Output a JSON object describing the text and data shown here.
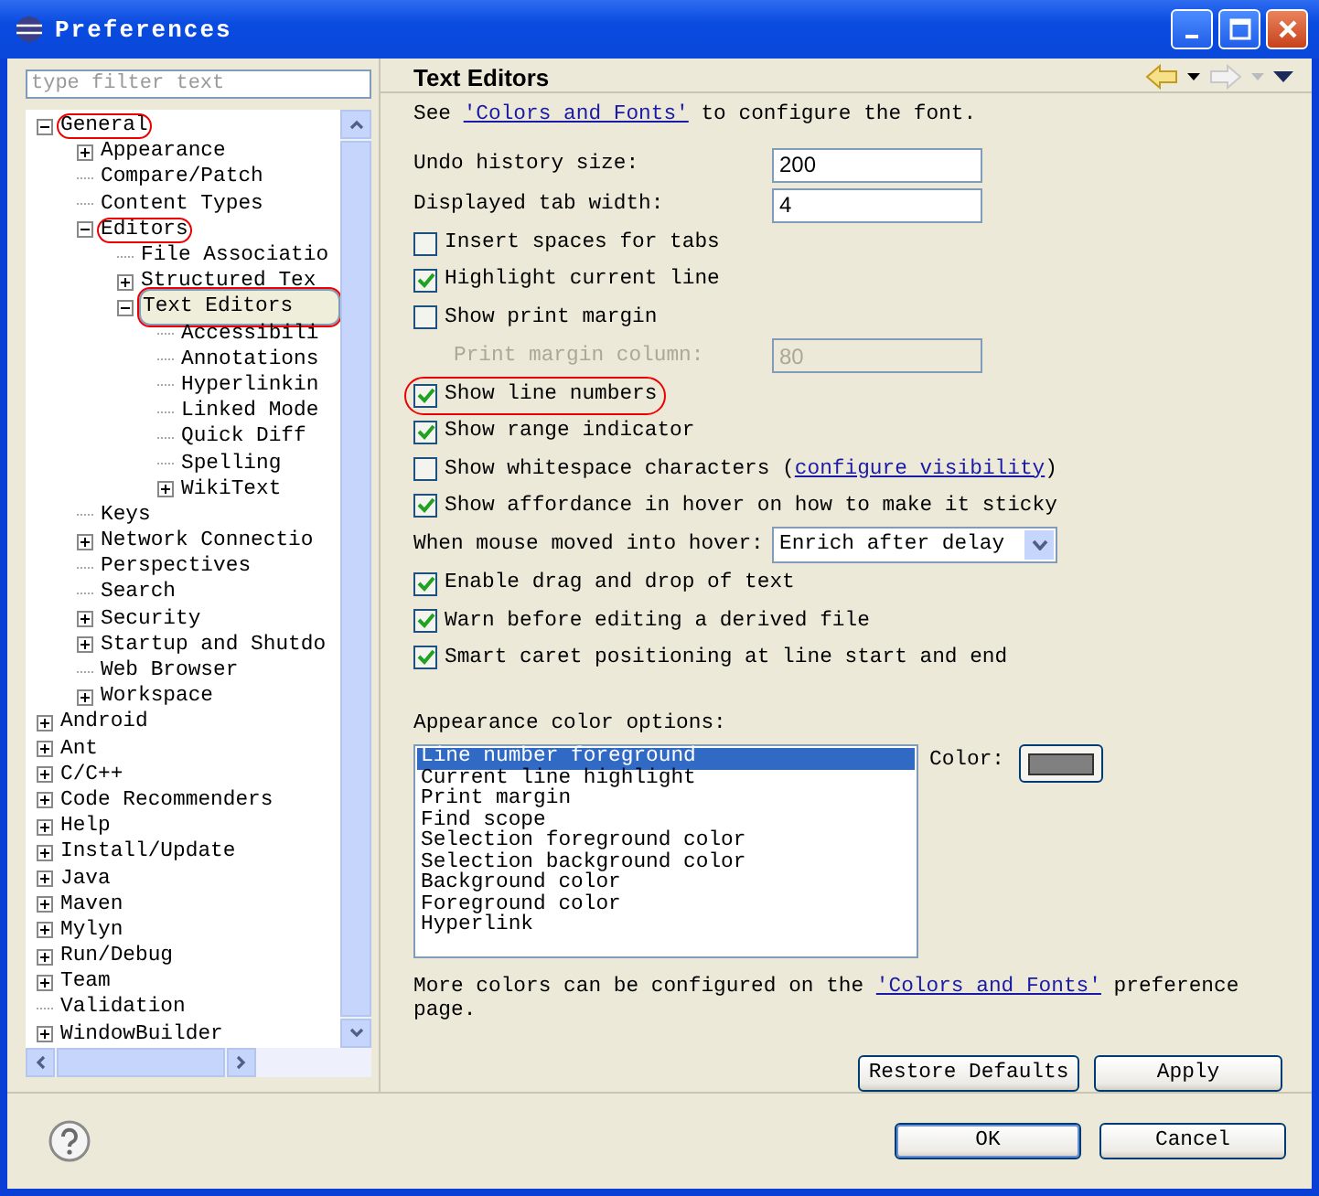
{
  "window": {
    "title": "Preferences"
  },
  "sidebar": {
    "filter": {
      "placeholder": "type filter text"
    },
    "tree": [
      {
        "label": "General",
        "expanded": true,
        "selected": false,
        "circled": true,
        "children": [
          {
            "label": "Appearance",
            "expanded": false,
            "selected": false,
            "circled": false
          },
          {
            "label": "Compare/Patch",
            "selected": false,
            "circled": false
          },
          {
            "label": "Content Types",
            "selected": false,
            "circled": false
          },
          {
            "label": "Editors",
            "expanded": true,
            "selected": false,
            "circled": true,
            "children": [
              {
                "label": "File Associatio",
                "selected": false,
                "circled": false
              },
              {
                "label": "Structured Tex",
                "expanded": false,
                "selected": false,
                "circled": false
              },
              {
                "label": "Text Editors",
                "expanded": true,
                "selected": true,
                "circled": true,
                "children": [
                  {
                    "label": "Accessibili",
                    "selected": false,
                    "circled": false
                  },
                  {
                    "label": "Annotations",
                    "selected": false,
                    "circled": false
                  },
                  {
                    "label": "Hyperlinkin",
                    "selected": false,
                    "circled": false
                  },
                  {
                    "label": "Linked Mode",
                    "selected": false,
                    "circled": false
                  },
                  {
                    "label": "Quick Diff",
                    "selected": false,
                    "circled": false
                  },
                  {
                    "label": "Spelling",
                    "selected": false,
                    "circled": false
                  },
                  {
                    "label": "WikiText",
                    "expanded": false,
                    "selected": false,
                    "circled": false
                  }
                ]
              }
            ]
          },
          {
            "label": "Keys",
            "selected": false,
            "circled": false
          },
          {
            "label": "Network Connectio",
            "expanded": false,
            "selected": false,
            "circled": false
          },
          {
            "label": "Perspectives",
            "selected": false,
            "circled": false
          },
          {
            "label": "Search",
            "selected": false,
            "circled": false
          },
          {
            "label": "Security",
            "expanded": false,
            "selected": false,
            "circled": false
          },
          {
            "label": "Startup and Shutdo",
            "expanded": false,
            "selected": false,
            "circled": false
          },
          {
            "label": "Web Browser",
            "selected": false,
            "circled": false
          },
          {
            "label": "Workspace",
            "expanded": false,
            "selected": false,
            "circled": false
          }
        ]
      },
      {
        "label": "Android",
        "expanded": false,
        "selected": false,
        "circled": false
      },
      {
        "label": "Ant",
        "expanded": false,
        "selected": false,
        "circled": false
      },
      {
        "label": "C/C++",
        "expanded": false,
        "selected": false,
        "circled": false
      },
      {
        "label": "Code Recommenders",
        "expanded": false,
        "selected": false,
        "circled": false
      },
      {
        "label": "Help",
        "expanded": false,
        "selected": false,
        "circled": false
      },
      {
        "label": "Install/Update",
        "expanded": false,
        "selected": false,
        "circled": false
      },
      {
        "label": "Java",
        "expanded": false,
        "selected": false,
        "circled": false
      },
      {
        "label": "Maven",
        "expanded": false,
        "selected": false,
        "circled": false
      },
      {
        "label": "Mylyn",
        "expanded": false,
        "selected": false,
        "circled": false
      },
      {
        "label": "Run/Debug",
        "expanded": false,
        "selected": false,
        "circled": false
      },
      {
        "label": "Team",
        "expanded": false,
        "selected": false,
        "circled": false
      },
      {
        "label": "Validation",
        "selected": false,
        "circled": false
      },
      {
        "label": "WindowBuilder",
        "expanded": false,
        "selected": false,
        "circled": false
      }
    ]
  },
  "page": {
    "title": "Text Editors",
    "intro": {
      "before": "See ",
      "link": "'Colors and Fonts'",
      "after": " to configure the font."
    },
    "options": [
      {
        "kind": "input",
        "label": "Undo history size:",
        "value": "200",
        "disabled": false
      },
      {
        "kind": "input",
        "label": "Displayed tab width:",
        "value": "4",
        "disabled": false
      },
      {
        "kind": "checkbox",
        "label": "Insert spaces for tabs",
        "checked": false,
        "circled": false
      },
      {
        "kind": "checkbox",
        "label": "Highlight current line",
        "checked": true,
        "circled": false
      },
      {
        "kind": "checkbox",
        "label": "Show print margin",
        "checked": false,
        "circled": false
      },
      {
        "kind": "input",
        "label": "Print margin column:",
        "value": "80",
        "disabled": true
      },
      {
        "kind": "checkbox",
        "label": "Show line numbers",
        "checked": true,
        "circled": true
      },
      {
        "kind": "checkbox",
        "label": "Show range indicator",
        "checked": true,
        "circled": false
      },
      {
        "kind": "checkbox",
        "label": "Show whitespace characters (",
        "link": "configure visibility",
        "after": ")",
        "checked": false,
        "circled": false
      },
      {
        "kind": "checkbox",
        "label": "Show affordance in hover on how to make it sticky",
        "checked": true,
        "circled": false
      },
      {
        "kind": "select",
        "label": "When mouse moved into hover:",
        "value": "Enrich after delay"
      },
      {
        "kind": "checkbox",
        "label": "Enable drag and drop of text",
        "checked": true,
        "circled": false
      },
      {
        "kind": "checkbox",
        "label": "Warn before editing a derived file",
        "checked": true,
        "circled": false
      },
      {
        "kind": "checkbox",
        "label": "Smart caret positioning at line start and end",
        "checked": true,
        "circled": false
      }
    ],
    "colors": {
      "label": "Appearance color options:",
      "items": [
        {
          "label": "Line number foreground",
          "selected": true
        },
        {
          "label": "Current line highlight",
          "selected": false
        },
        {
          "label": "Print margin",
          "selected": false
        },
        {
          "label": "Find scope",
          "selected": false
        },
        {
          "label": "Selection foreground color",
          "selected": false
        },
        {
          "label": "Selection background color",
          "selected": false
        },
        {
          "label": "Background color",
          "selected": false
        },
        {
          "label": "Foreground color",
          "selected": false
        },
        {
          "label": "Hyperlink",
          "selected": false
        }
      ],
      "color_label": "Color:"
    },
    "note": {
      "before": "More colors can be configured on the ",
      "link": "'Colors and Fonts'",
      "after": " preference page."
    },
    "buttons": [
      "Restore Defaults",
      "Apply"
    ]
  },
  "footer": {
    "buttons": [
      "OK",
      "Cancel"
    ]
  }
}
